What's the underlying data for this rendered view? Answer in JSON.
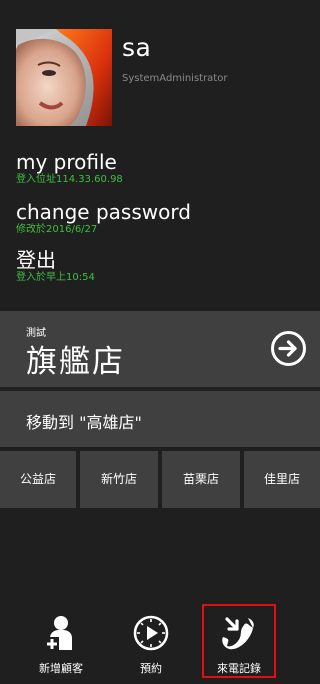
{
  "profile": {
    "username": "sa",
    "role": "SystemAdministrator"
  },
  "menu": [
    {
      "title": "my profile",
      "sub": "登入位址114.33.60.98"
    },
    {
      "title": "change password",
      "sub": "修改於2016/6/27"
    },
    {
      "title": "登出",
      "sub": "登入於早上10:54"
    }
  ],
  "store": {
    "tag": "測試",
    "name": "旗艦店"
  },
  "move": {
    "label": "移動到 \"高雄店\""
  },
  "branches": [
    "公益店",
    "新竹店",
    "苗栗店",
    "佳里店"
  ],
  "tabs": [
    {
      "label": "新增顧客",
      "icon": "add-user-icon"
    },
    {
      "label": "預約",
      "icon": "clock-icon"
    },
    {
      "label": "來電記錄",
      "icon": "incoming-call-icon"
    }
  ],
  "colors": {
    "background": "#1f1f1f",
    "tile": "#404040",
    "sub_text": "#3fbf3f",
    "highlight": "#e01010"
  }
}
